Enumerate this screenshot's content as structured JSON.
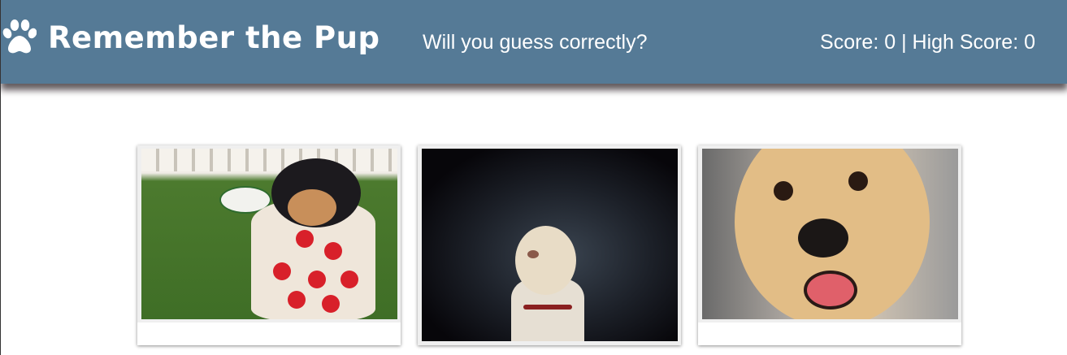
{
  "header": {
    "logo_icon": "paw-icon",
    "title": "Remember the Pup",
    "tagline": "Will you guess correctly?",
    "score_text": "Score: 0 | High Score: 0"
  },
  "colors": {
    "header_bg": "#557a96",
    "header_text": "#ffffff"
  },
  "cards": [
    {
      "image": "puppy in polka-dot cup"
    },
    {
      "image": "labrador on dark background"
    },
    {
      "image": "golden retriever close-up"
    }
  ]
}
